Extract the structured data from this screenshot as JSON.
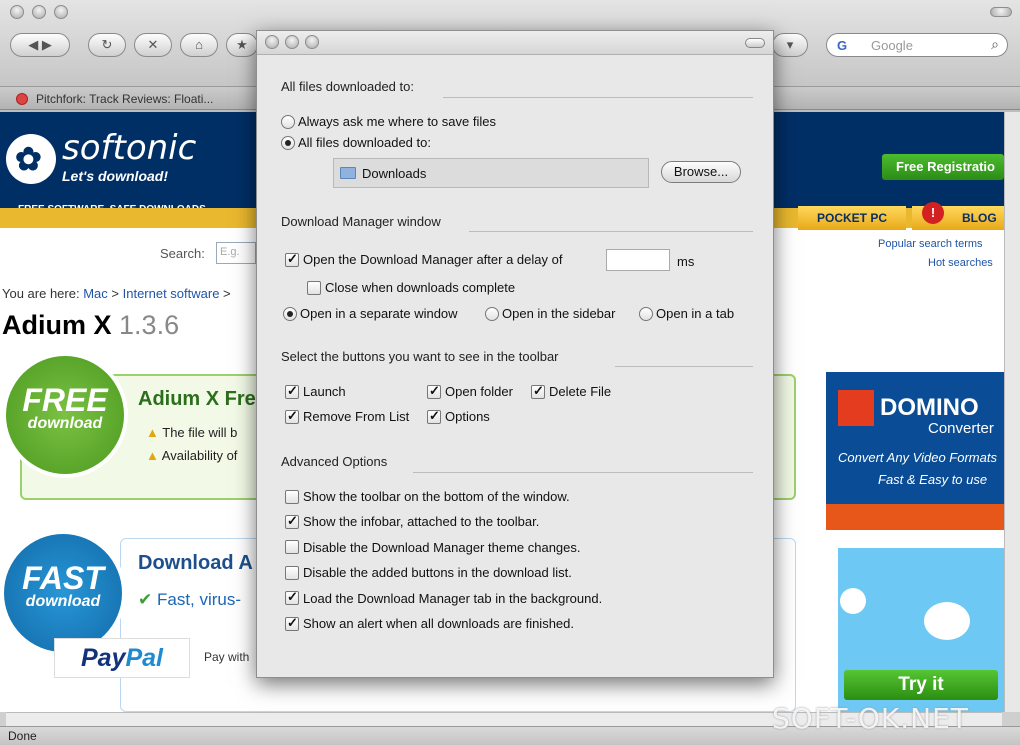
{
  "browser": {
    "search_placeholder": "Google",
    "search_provider_glyph": "G",
    "tab_title": "Pitchfork: Track Reviews: Floati...",
    "status": "Done"
  },
  "page": {
    "brand": "softonic",
    "slogan": "Let's download!",
    "tagline": "FREE SOFTWARE. SAFE DOWNLOADS.",
    "register": "Free Registratio",
    "tabs": [
      "POCKET PC",
      "BLOG"
    ],
    "search_label": "Search:",
    "search_placeholder": "E.g.",
    "popular": "Popular search terms",
    "hot": "Hot searches",
    "breadcrumb_prefix": "You are here:",
    "breadcrumb": [
      "Mac",
      "Internet software"
    ],
    "title": "Adium X",
    "version": "1.3.6",
    "free_badge": [
      "FREE",
      "download"
    ],
    "free_heading": "Adium X Fre",
    "free_notes": [
      "The file will b",
      "Availability of"
    ],
    "fast_badge": [
      "FAST",
      "download"
    ],
    "dl_heading": "Download A",
    "fast_line": "Fast, virus-",
    "paypal": [
      "Pay",
      "Pal"
    ],
    "pay_with": "Pay with",
    "ad_domino": {
      "title": "DOMINO",
      "subtitle": "Converter",
      "line1": "Convert Any Video Formats",
      "line2": "Fast & Easy to use"
    },
    "try_it": "Try it",
    "watermark": "SOFT-OK.NET"
  },
  "dialog": {
    "sec_files": "All files downloaded to:",
    "radio_ask": "Always ask me where to save files",
    "radio_all": "All files downloaded to:",
    "folder": "Downloads",
    "browse": "Browse...",
    "sec_window": "Download Manager window",
    "open_delay": "Open the Download Manager after a delay of",
    "delay_value": "",
    "ms": "ms",
    "close_complete": "Close when downloads complete",
    "open_separate": "Open in a separate window",
    "open_sidebar": "Open in the sidebar",
    "open_tab": "Open in a tab",
    "sec_toolbar": "Select the buttons you want to see in the toolbar",
    "launch": "Launch",
    "open_folder": "Open folder",
    "delete_file": "Delete File",
    "remove_list": "Remove From List",
    "options": "Options",
    "sec_advanced": "Advanced Options",
    "adv": [
      {
        "label": "Show the toolbar on the bottom of the window.",
        "checked": false
      },
      {
        "label": "Show the infobar, attached to the toolbar.",
        "checked": true
      },
      {
        "label": "Disable the Download Manager theme changes.",
        "checked": false
      },
      {
        "label": "Disable the added buttons in the download list.",
        "checked": false
      },
      {
        "label": "Load the Download Manager tab in the background.",
        "checked": true
      },
      {
        "label": "Show an alert when all downloads are finished.",
        "checked": true
      }
    ]
  }
}
